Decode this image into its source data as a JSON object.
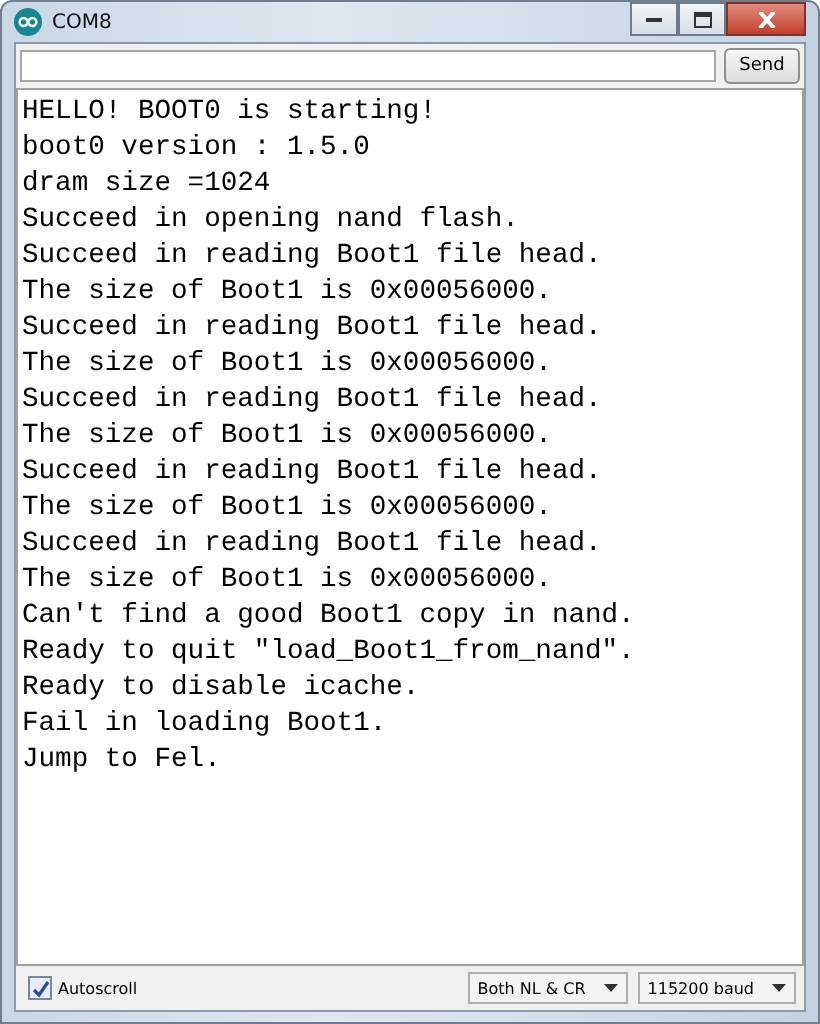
{
  "window": {
    "title": "COM8"
  },
  "send_button": "Send",
  "output_lines": [
    "HELLO! BOOT0 is starting!",
    "boot0 version : 1.5.0",
    "dram size =1024",
    "Succeed in opening nand flash.",
    "Succeed in reading Boot1 file head.",
    "The size of Boot1 is 0x00056000.",
    "Succeed in reading Boot1 file head.",
    "The size of Boot1 is 0x00056000.",
    "Succeed in reading Boot1 file head.",
    "The size of Boot1 is 0x00056000.",
    "Succeed in reading Boot1 file head.",
    "The size of Boot1 is 0x00056000.",
    "Succeed in reading Boot1 file head.",
    "The size of Boot1 is 0x00056000.",
    "Can't find a good Boot1 copy in nand.",
    "Ready to quit \"load_Boot1_from_nand\".",
    "Ready to disable icache.",
    "Fail in loading Boot1.",
    "Jump to Fel."
  ],
  "autoscroll": {
    "label": "Autoscroll",
    "checked": true
  },
  "line_ending": {
    "value": "Both NL & CR"
  },
  "baud": {
    "value": "115200 baud"
  }
}
